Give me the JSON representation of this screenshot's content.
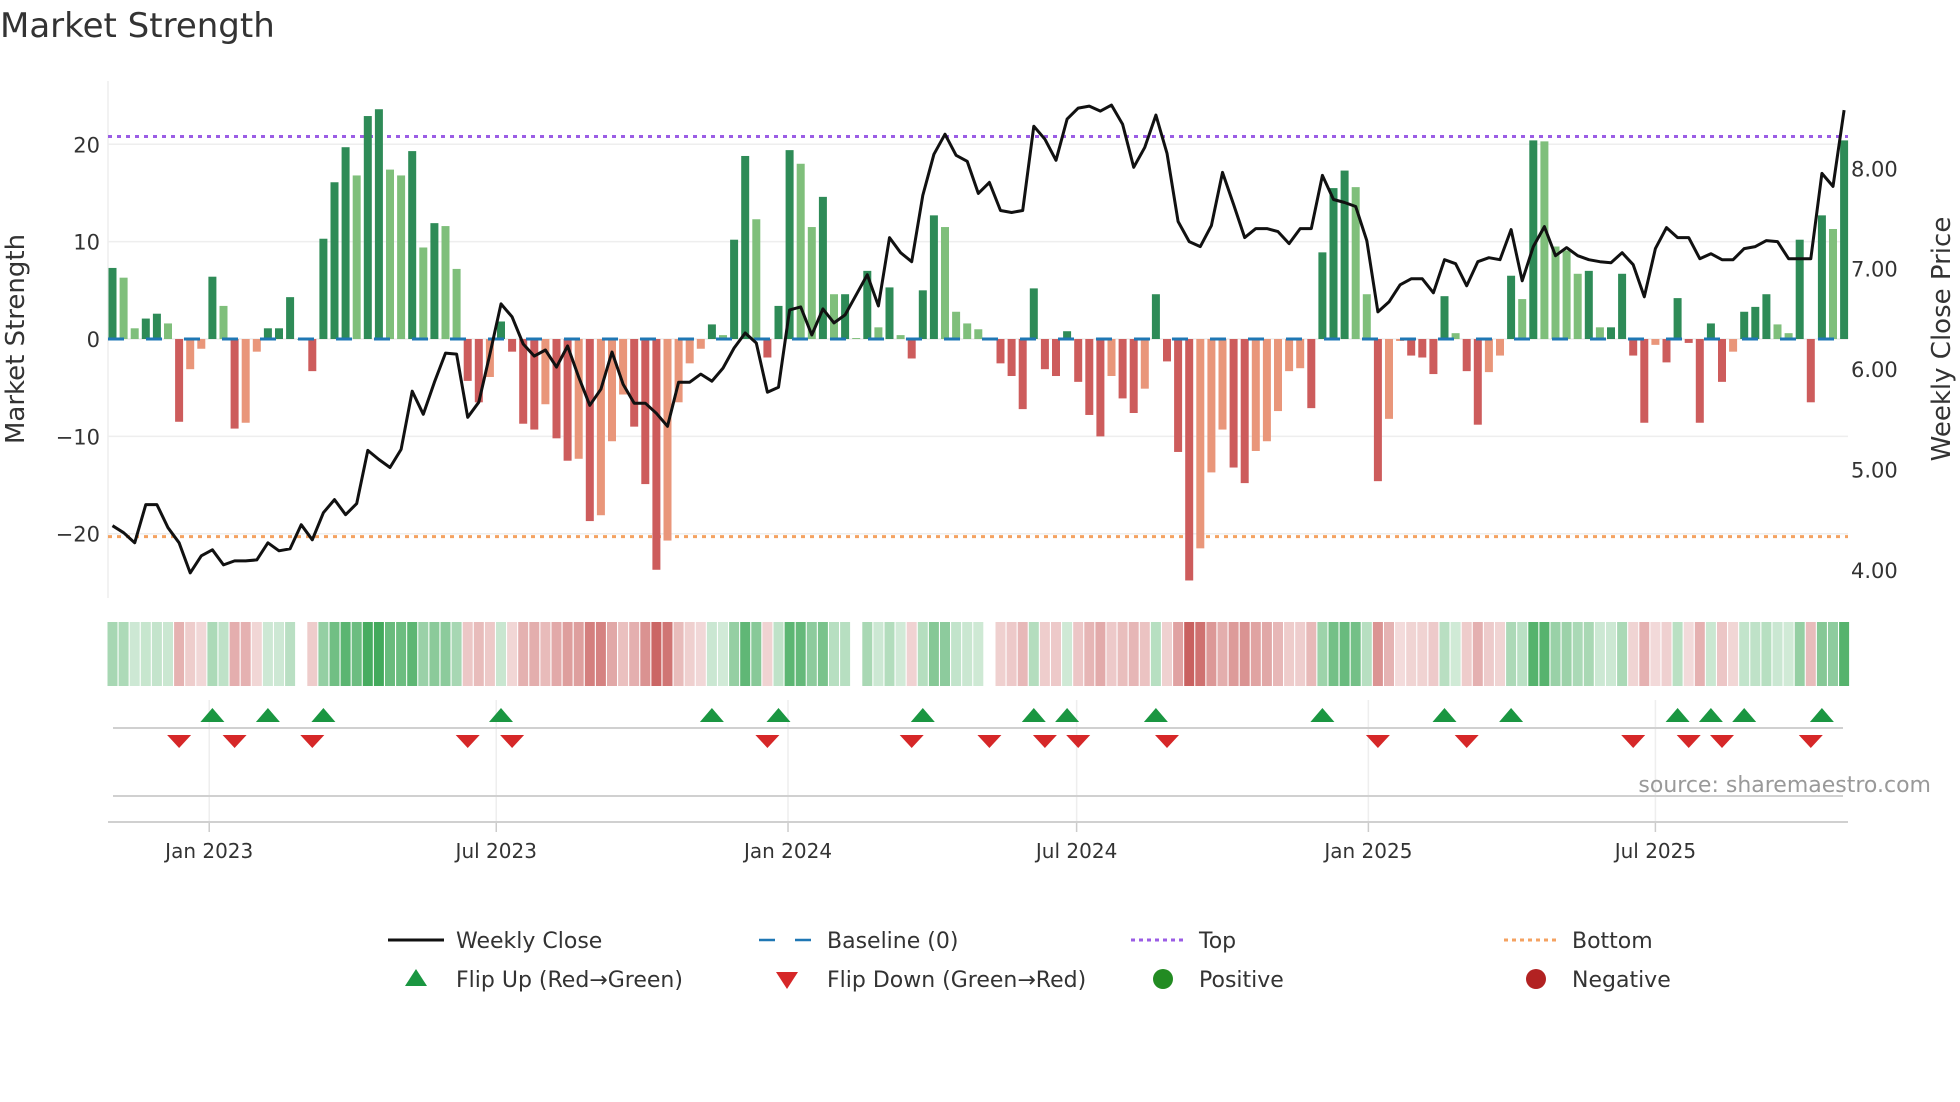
{
  "chart_data": {
    "type": "bar",
    "title": "Market Strength",
    "ylabel": "Market Strength",
    "y2label": "Weekly Close Price",
    "frequency": "weekly",
    "start_date": "2022-11-01",
    "ylim": [
      -26.6,
      26.5
    ],
    "y2lim": [
      3.72,
      8.87
    ],
    "yticks": [
      -20,
      -10,
      0,
      10,
      20
    ],
    "ytick_labels": [
      "−20",
      "−10",
      "0",
      "10",
      "20"
    ],
    "y2ticks": [
      4,
      5,
      6,
      7,
      8
    ],
    "y2tick_labels": [
      "4.00",
      "5.00",
      "6.00",
      "7.00",
      "8.00"
    ],
    "xticks": [
      {
        "date": "2023-01-01",
        "label": "Jan 2023"
      },
      {
        "date": "2023-07-01",
        "label": "Jul 2023"
      },
      {
        "date": "2024-01-01",
        "label": "Jan 2024"
      },
      {
        "date": "2024-07-01",
        "label": "Jul 2024"
      },
      {
        "date": "2025-01-01",
        "label": "Jan 2025"
      },
      {
        "date": "2025-07-01",
        "label": "Jul 2025"
      }
    ],
    "top_level": 20.8,
    "bottom_level": -20.3,
    "baseline": 0,
    "strength": [
      7.3,
      6.3,
      1.1,
      2.1,
      2.6,
      1.6,
      -8.5,
      -3.1,
      -1.0,
      6.4,
      3.4,
      -9.2,
      -8.6,
      -1.3,
      1.1,
      1.1,
      4.3,
      0,
      -3.3,
      10.3,
      16.1,
      19.7,
      16.8,
      22.9,
      23.6,
      17.4,
      16.8,
      19.3,
      9.4,
      11.9,
      11.6,
      7.2,
      -4.3,
      -6.5,
      -3.9,
      1.8,
      -1.3,
      -8.7,
      -9.3,
      -6.7,
      -10.2,
      -12.5,
      -12.3,
      -18.7,
      -18.1,
      -10.5,
      -5.7,
      -9.0,
      -14.9,
      -23.7,
      -20.7,
      -6.5,
      -2.5,
      -1.0,
      1.5,
      0.4,
      10.2,
      18.8,
      12.3,
      -1.9,
      3.4,
      19.4,
      18.0,
      11.5,
      14.6,
      4.6,
      4.6,
      0.1,
      7.0,
      1.2,
      5.3,
      0.4,
      -2.0,
      5.0,
      12.7,
      11.5,
      2.8,
      1.6,
      1.0,
      -0.1,
      -2.5,
      -3.8,
      -7.2,
      5.2,
      -3.1,
      -3.8,
      0.8,
      -4.4,
      -7.8,
      -10.0,
      -3.8,
      -6.1,
      -7.6,
      -5.1,
      4.6,
      -2.3,
      -11.6,
      -24.8,
      -21.5,
      -13.7,
      -9.3,
      -13.2,
      -14.8,
      -11.5,
      -10.5,
      -7.4,
      -3.3,
      -3.0,
      -7.1,
      8.9,
      15.5,
      17.3,
      15.6,
      4.6,
      -14.6,
      -8.2,
      -0.2,
      -1.7,
      -1.9,
      -3.6,
      4.4,
      0.6,
      -3.3,
      -8.8,
      -3.4,
      -1.7,
      6.5,
      4.1,
      20.4,
      20.3,
      9.5,
      9.1,
      6.7,
      7.0,
      1.2,
      1.2,
      6.7,
      -1.7,
      -8.6,
      -0.6,
      -2.4,
      4.2,
      -0.4,
      -8.6,
      1.6,
      -4.4,
      -1.3,
      2.8,
      3.3,
      4.6,
      1.5,
      0.6,
      10.2,
      -6.5,
      12.7,
      11.3,
      20.4
    ],
    "close": [
      4.44,
      4.37,
      4.27,
      4.65,
      4.65,
      4.42,
      4.27,
      3.97,
      4.14,
      4.2,
      4.05,
      4.09,
      4.09,
      4.1,
      4.27,
      4.19,
      4.21,
      4.45,
      4.3,
      4.57,
      4.7,
      4.55,
      4.66,
      5.19,
      5.1,
      5.02,
      5.2,
      5.78,
      5.55,
      5.87,
      6.16,
      6.15,
      5.52,
      5.67,
      6.15,
      6.65,
      6.52,
      6.25,
      6.13,
      6.19,
      6.02,
      6.23,
      5.92,
      5.64,
      5.8,
      6.17,
      5.85,
      5.66,
      5.66,
      5.56,
      5.43,
      5.87,
      5.87,
      5.95,
      5.88,
      6.01,
      6.21,
      6.36,
      6.26,
      5.77,
      5.82,
      6.59,
      6.62,
      6.34,
      6.6,
      6.46,
      6.54,
      6.74,
      6.94,
      6.63,
      7.31,
      7.16,
      7.07,
      7.73,
      8.14,
      8.34,
      8.13,
      8.07,
      7.75,
      7.86,
      7.58,
      7.56,
      7.58,
      8.42,
      8.29,
      8.08,
      8.49,
      8.6,
      8.62,
      8.57,
      8.63,
      8.44,
      8.01,
      8.21,
      8.53,
      8.15,
      7.47,
      7.27,
      7.22,
      7.43,
      7.96,
      7.64,
      7.31,
      7.4,
      7.4,
      7.37,
      7.25,
      7.4,
      7.4,
      7.93,
      7.69,
      7.66,
      7.62,
      7.28,
      6.57,
      6.67,
      6.84,
      6.9,
      6.9,
      6.76,
      7.09,
      7.05,
      6.83,
      7.07,
      7.11,
      7.09,
      7.39,
      6.88,
      7.22,
      7.42,
      7.13,
      7.21,
      7.13,
      7.09,
      7.07,
      7.06,
      7.16,
      7.04,
      6.72,
      7.2,
      7.41,
      7.31,
      7.31,
      7.1,
      7.15,
      7.09,
      7.09,
      7.2,
      7.22,
      7.28,
      7.27,
      7.1,
      7.1,
      7.1,
      7.95,
      7.82,
      8.58
    ],
    "legend": {
      "placement": "bottom",
      "items": [
        {
          "label": "Weekly Close",
          "symbol": "line"
        },
        {
          "label": "Baseline (0)",
          "symbol": "dash"
        },
        {
          "label": "Top",
          "symbol": "dot-purple"
        },
        {
          "label": "Bottom",
          "symbol": "dot-orange"
        },
        {
          "label": "Flip Up (Red→Green)",
          "symbol": "triangle-up"
        },
        {
          "label": "Flip Down (Green→Red)",
          "symbol": "triangle-down"
        },
        {
          "label": "Positive",
          "symbol": "circle-green"
        },
        {
          "label": "Negative",
          "symbol": "circle-red"
        }
      ]
    },
    "source": "source: sharemaestro.com",
    "colors": {
      "pos_strong": "#2e8b57",
      "pos_weak": "#7fbf7b",
      "neg_strong": "#cd5c5c",
      "neg_weak": "#e9967a",
      "close": "#111111",
      "baseline": "#1f77b4",
      "top": "#9b5de5",
      "bottom": "#f4a261",
      "flip_up": "#1a9641",
      "flip_down": "#d62728",
      "positive": "#228b22",
      "negative": "#b22222",
      "heat_pos": "#3aa655",
      "heat_neg": "#c9605f"
    }
  }
}
